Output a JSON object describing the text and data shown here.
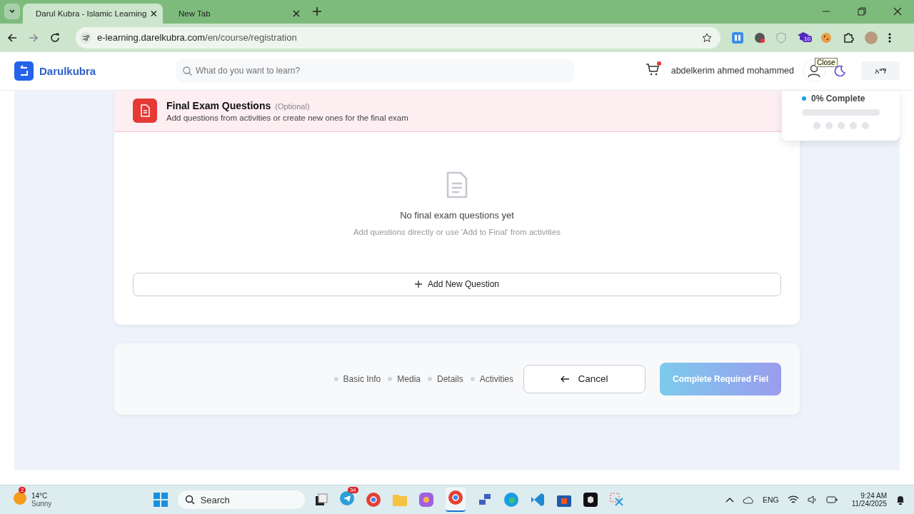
{
  "browser": {
    "tabs": [
      {
        "title": "Darul Kubra - Islamic Learning",
        "selected": true
      },
      {
        "title": "New Tab",
        "selected": false
      }
    ],
    "url_host": "e-learning.darelkubra.com",
    "url_path": "/en/course/registration",
    "extension_badge": "10"
  },
  "header": {
    "logo": "Darulkubra",
    "search_placeholder": "What do you want to learn?",
    "cart_has_items": true,
    "user_name": "abdelkerim ahmed mohammed",
    "tooltip": "Close",
    "language": "አማ"
  },
  "progress": {
    "label": "0% Complete",
    "level": 0,
    "steps": [
      {
        "done": false
      },
      {
        "done": false
      },
      {
        "done": false
      },
      {
        "done": false
      },
      {
        "done": false
      }
    ]
  },
  "section": {
    "title": "Final Exam Questions",
    "optional": "(Optional)",
    "subtitle": "Add questions from activities or create new ones for the final exam",
    "empty_title": "No final exam questions yet",
    "empty_hint": "Add questions directly or use 'Add to Final' from activities",
    "add_button": "Add New Question"
  },
  "footer": {
    "steps": [
      {
        "label": "Basic Info",
        "done": false
      },
      {
        "label": "Media",
        "done": false
      },
      {
        "label": "Details",
        "done": false
      },
      {
        "label": "Activities",
        "done": false
      }
    ],
    "cancel": "Cancel",
    "submit": "Complete Required Fiel"
  },
  "taskbar": {
    "weather_badge": "2",
    "temperature": "14°C",
    "condition": "Sunny",
    "search": "Search",
    "telegram_badge": "34",
    "language": "ENG",
    "time": "9:24 AM",
    "date": "11/24/2025"
  }
}
